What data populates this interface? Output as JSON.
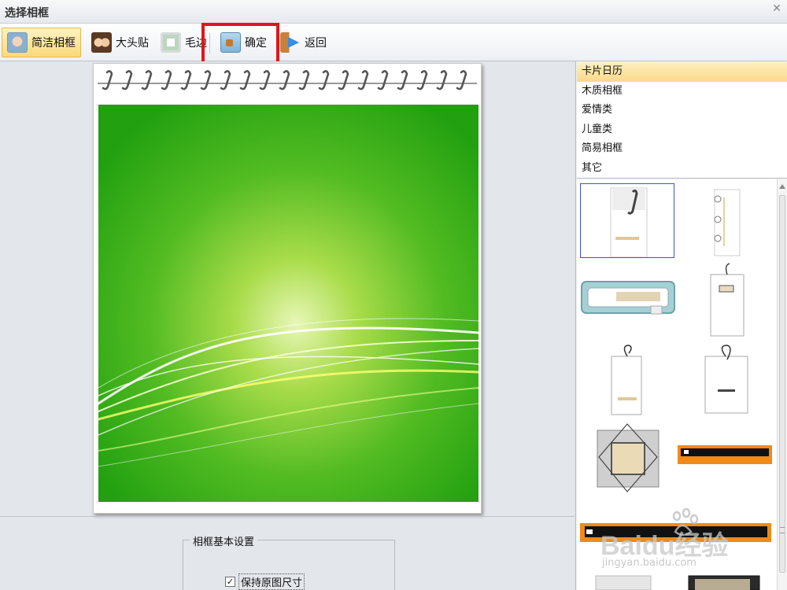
{
  "window": {
    "title": "选择相框"
  },
  "toolbar": {
    "buttons": [
      {
        "label": "简洁相框",
        "icon": "portrait-frame-icon",
        "active": true
      },
      {
        "label": "大头贴",
        "icon": "kids-photo-icon",
        "active": false
      },
      {
        "label": "毛边",
        "icon": "rough-edge-frame-icon",
        "active": false
      },
      {
        "label": "确定",
        "icon": "confirm-picture-icon",
        "active": false
      },
      {
        "label": "返回",
        "icon": "back-arrow-icon",
        "active": false
      }
    ]
  },
  "categories": {
    "selected_index": 0,
    "items": [
      "卡片日历",
      "木质相框",
      "爱情类",
      "儿童类",
      "简易相框",
      "其它"
    ]
  },
  "thumbnails": {
    "selected_index": 0,
    "items": [
      "calendar-card-1",
      "ring-tag-2",
      "teal-badge-3",
      "hanging-tag-4",
      "hanging-tag-5",
      "hanging-tag-6",
      "beige-cross-frame-7",
      "orange-strip-8",
      "orange-strip-9",
      "gray-frame-10",
      "dark-frame-11"
    ]
  },
  "settings": {
    "group_label": "相框基本设置",
    "keep_size_label": "保持原图尺寸",
    "keep_size_checked": true
  },
  "watermark": {
    "brand": "Baidu经验",
    "url": "jingyan.baidu.com"
  },
  "colors": {
    "highlight": "#e0151c",
    "active_button": "#fad97a",
    "selected_category": "#fbd98a",
    "preview_green": "#2aa818"
  }
}
